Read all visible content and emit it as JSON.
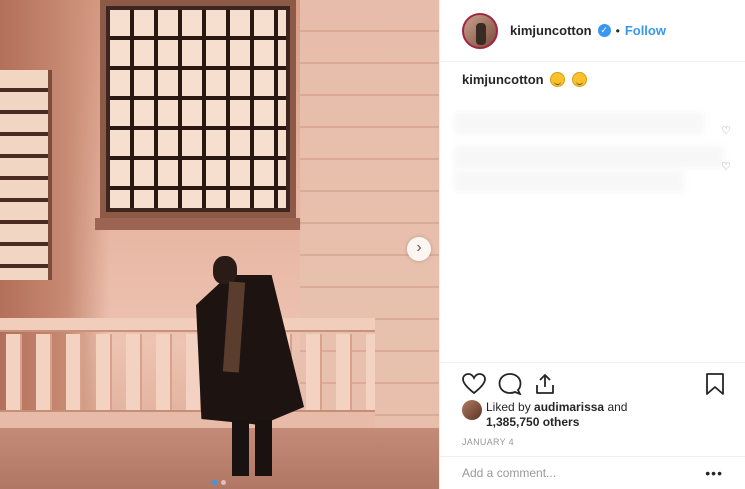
{
  "header": {
    "username": "kimjuncotton",
    "separator": "•",
    "follow_label": "Follow",
    "verified_icon": "verified-badge-icon"
  },
  "caption": {
    "username": "kimjuncotton",
    "emojis": [
      "smiling-face-icon",
      "smiling-face-icon"
    ]
  },
  "actions": {
    "icons": [
      "heart-icon",
      "comment-icon",
      "share-icon",
      "bookmark-icon"
    ]
  },
  "likes": {
    "prefix": "Liked by",
    "user": "audimarissa",
    "and": "and",
    "count": "1,385,750 others"
  },
  "date": "JANUARY 4",
  "comment_input": {
    "placeholder": "Add a comment..."
  },
  "more_label": "•••",
  "photo": {
    "next_label": "›",
    "dots": 2,
    "active_dot": 0
  },
  "colors": {
    "accent": "#3897f0",
    "text": "#262626",
    "muted": "#999999",
    "border": "#efefef"
  }
}
